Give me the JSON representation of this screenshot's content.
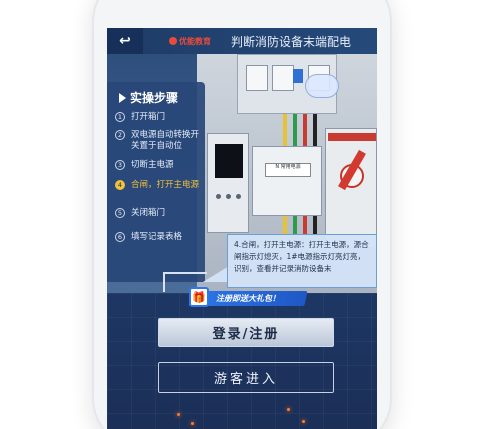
{
  "header": {
    "back_label": "↩",
    "logo_text": "优能教育",
    "title": "判断消防设备末端配电"
  },
  "scene": {
    "cabinet_plate": "N\n常用电源"
  },
  "steps": {
    "title": "实操步骤",
    "items": [
      {
        "num": "1",
        "label": "打开箱门"
      },
      {
        "num": "2",
        "label": "双电源自动转换开关置于自动位"
      },
      {
        "num": "3",
        "label": "切断主电源"
      },
      {
        "num": "4",
        "label": "合闸，打开主电源"
      },
      {
        "num": "5",
        "label": "关闭箱门"
      },
      {
        "num": "6",
        "label": "填写记录表格"
      }
    ],
    "active_index": 3
  },
  "tooltip": {
    "text": "4.合闸，打开主电源：打开主电源，源合闸指示灯熄灭，1#电源指示灯亮灯亮，识别，查看并记录消防设备末"
  },
  "promo": {
    "gift_icon": "gift-icon",
    "label": "注册即送大礼包！"
  },
  "buttons": {
    "login": "登录/注册",
    "guest": "游客进入"
  },
  "colors": {
    "accent_blue": "#2d77e8",
    "active_step": "#f0c23a",
    "bg_dark": "#1b3360"
  }
}
